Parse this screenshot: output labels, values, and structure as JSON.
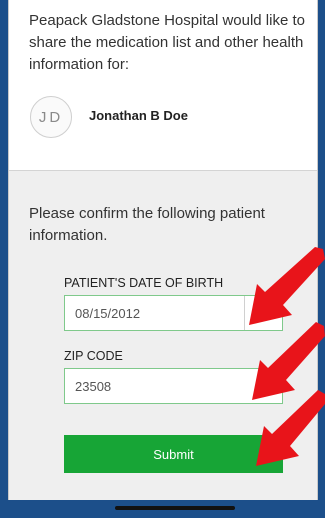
{
  "intro_text": "Peapack Gladstone Hospital would like to share the medication list and other health information for:",
  "patient": {
    "initials": "JD",
    "name": "Jonathan B Doe"
  },
  "confirm_text": "Please confirm the following patient information.",
  "dob": {
    "label": "PATIENT'S DATE OF BIRTH",
    "value": "08/15/2012"
  },
  "zip": {
    "label": "ZIP CODE",
    "value": "23508"
  },
  "submit_label": "Submit",
  "colors": {
    "accent_green": "#17a536",
    "arrow_red": "#e8141a",
    "frame_blue": "#1c4f8a"
  }
}
